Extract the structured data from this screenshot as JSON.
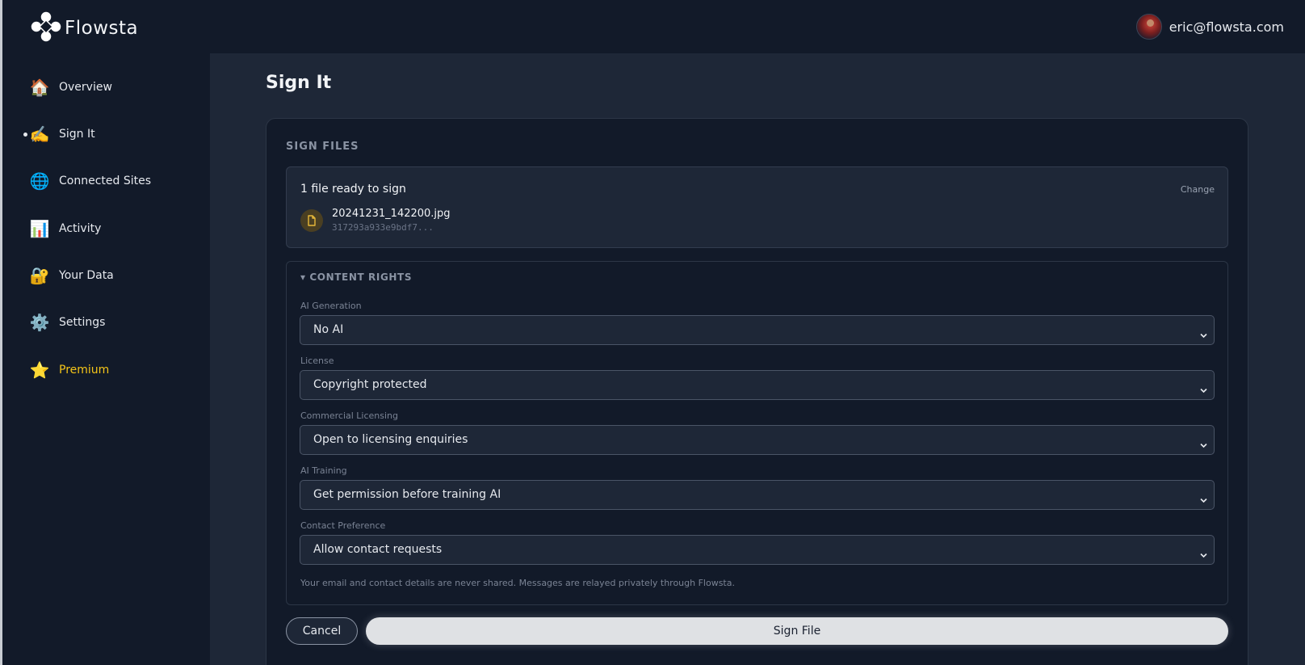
{
  "app": {
    "name": "Flowsta"
  },
  "user": {
    "email": "eric@flowsta.com"
  },
  "sidebar": {
    "items": [
      {
        "label": "Overview",
        "icon": "🏠",
        "icon_name": "house-icon"
      },
      {
        "label": "Sign It",
        "icon": "✍️",
        "icon_name": "writing-hand-icon",
        "active": true
      },
      {
        "label": "Connected Sites",
        "icon": "🌐",
        "icon_name": "globe-icon"
      },
      {
        "label": "Activity",
        "icon": "📊",
        "icon_name": "bar-chart-icon"
      },
      {
        "label": "Your Data",
        "icon": "🔐",
        "icon_name": "lock-key-icon"
      },
      {
        "label": "Settings",
        "icon": "⚙️",
        "icon_name": "gear-icon"
      },
      {
        "label": "Premium",
        "icon": "⭐",
        "icon_name": "star-icon",
        "accent": "#f5c518"
      }
    ]
  },
  "main": {
    "page_title": "Sign It",
    "section_label": "SIGN FILES",
    "file_box": {
      "ready_text": "1 file ready to sign",
      "change_label": "Change",
      "file": {
        "name": "20241231_142200.jpg",
        "hash": "317293a933e9bdf7..."
      }
    },
    "rights": {
      "heading": "▾ CONTENT RIGHTS",
      "fields": [
        {
          "label": "AI Generation",
          "value": "No AI"
        },
        {
          "label": "License",
          "value": "Copyright protected"
        },
        {
          "label": "Commercial Licensing",
          "value": "Open to licensing enquiries"
        },
        {
          "label": "AI Training",
          "value": "Get permission before training AI"
        },
        {
          "label": "Contact Preference",
          "value": "Allow contact requests"
        }
      ],
      "helper": "Your email and contact details are never shared. Messages are relayed privately through Flowsta."
    },
    "actions": {
      "cancel_label": "Cancel",
      "sign_label": "Sign File"
    }
  },
  "colors": {
    "background": "#0f1623",
    "panel": "#121a29",
    "main": "#1e2737",
    "premium": "#f5c518",
    "primary_button": "#dfe1e4"
  }
}
